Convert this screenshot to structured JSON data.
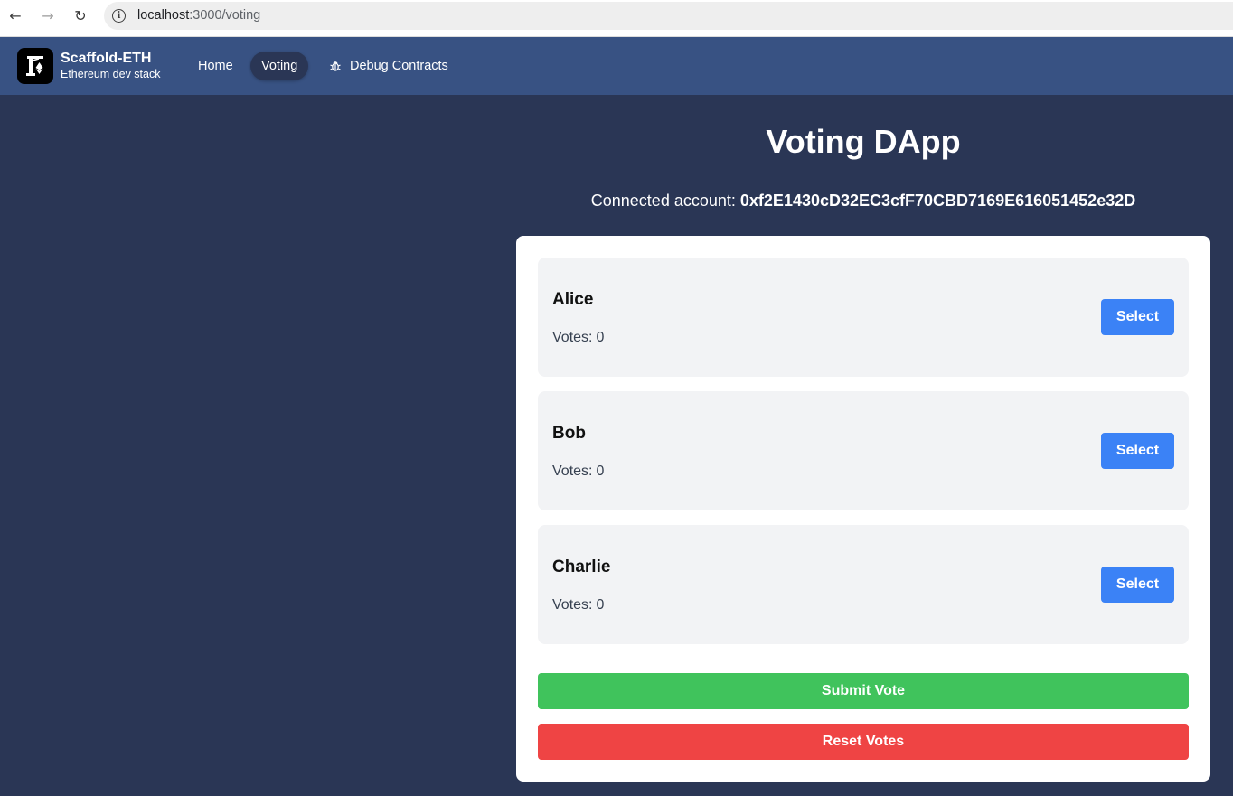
{
  "browser": {
    "back_icon": "←",
    "forward_icon": "→",
    "reload_icon": "↻",
    "info_icon": "i",
    "url_host": "localhost",
    "url_path": ":3000/voting"
  },
  "header": {
    "brand_title": "Scaffold-ETH",
    "brand_subtitle": "Ethereum dev stack",
    "nav": [
      {
        "label": "Home"
      },
      {
        "label": "Voting"
      },
      {
        "label": "Debug Contracts"
      }
    ],
    "active_nav": "Voting"
  },
  "main": {
    "title": "Voting DApp",
    "account_label": "Connected account:",
    "account_address": "0xf2E1430cD32EC3cfF70CBD7169E616051452e32D",
    "candidates": [
      {
        "name": "Alice",
        "votes_label": "Votes:",
        "votes": "0",
        "button": "Select"
      },
      {
        "name": "Bob",
        "votes_label": "Votes:",
        "votes": "0",
        "button": "Select"
      },
      {
        "name": "Charlie",
        "votes_label": "Votes:",
        "votes": "0",
        "button": "Select"
      }
    ],
    "submit_label": "Submit Vote",
    "reset_label": "Reset Votes"
  },
  "colors": {
    "background": "#2a3655",
    "header": "#385283",
    "select_button": "#3b82f6",
    "submit_button": "#40c35c",
    "reset_button": "#ef4444"
  }
}
